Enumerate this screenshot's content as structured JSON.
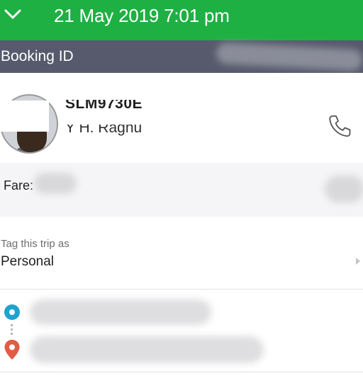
{
  "header": {
    "title": "21 May 2019 7:01 pm",
    "collapse_icon": "chevron-down-icon",
    "background_color": "#1fb043"
  },
  "booking": {
    "id_label": "Booking ID",
    "bar_color": "#565a6c"
  },
  "driver": {
    "plate_partial": "SLM9730E",
    "name_partial": "Y H. Ragnu",
    "call_icon": "phone-icon"
  },
  "fare": {
    "label": "Fare:"
  },
  "trip_tag": {
    "caption": "Tag this trip as",
    "value": "Personal",
    "arrow_icon": "chevron-right-icon"
  },
  "route": {
    "pickup_icon": "pickup-dot-icon",
    "pickup_color": "#1ea2cf",
    "dropoff_icon": "location-pin-icon",
    "dropoff_color": "#e05c45"
  }
}
